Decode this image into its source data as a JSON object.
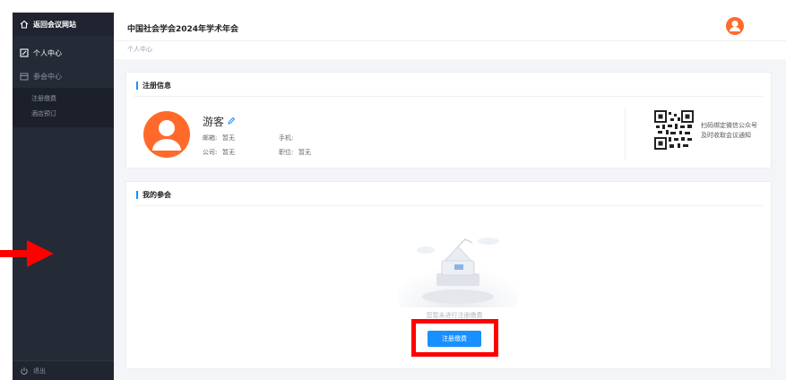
{
  "sidebar": {
    "home_label": "返回会议网站",
    "personal_label": "个人中心",
    "meeting_label": "参会中心",
    "sub_items": [
      {
        "label": "注册缴费"
      },
      {
        "label": "酒店预订"
      }
    ],
    "logout_label": "退出"
  },
  "header": {
    "title": "中国社会学会2024年学术年会"
  },
  "breadcrumb": "个人中心",
  "registration": {
    "title": "注册信息",
    "name": "游客",
    "email_label": "邮箱:",
    "email_value": "暂无",
    "company_label": "公司:",
    "company_value": "暂无",
    "phone_label": "手机:",
    "phone_value": "",
    "position_label": "职位:",
    "position_value": "暂无",
    "qr_text_line1": "扫码绑定微信公众号",
    "qr_text_line2": "及时收取会议通知"
  },
  "my_meetings": {
    "title": "我的参会",
    "empty_text": "您暂未进行注册缴费",
    "button_label": "注册缴费"
  },
  "colors": {
    "sidebar_bg": "#242a36",
    "accent": "#1890ff",
    "avatar": "#ff6a2a",
    "highlight": "#ff0000"
  }
}
